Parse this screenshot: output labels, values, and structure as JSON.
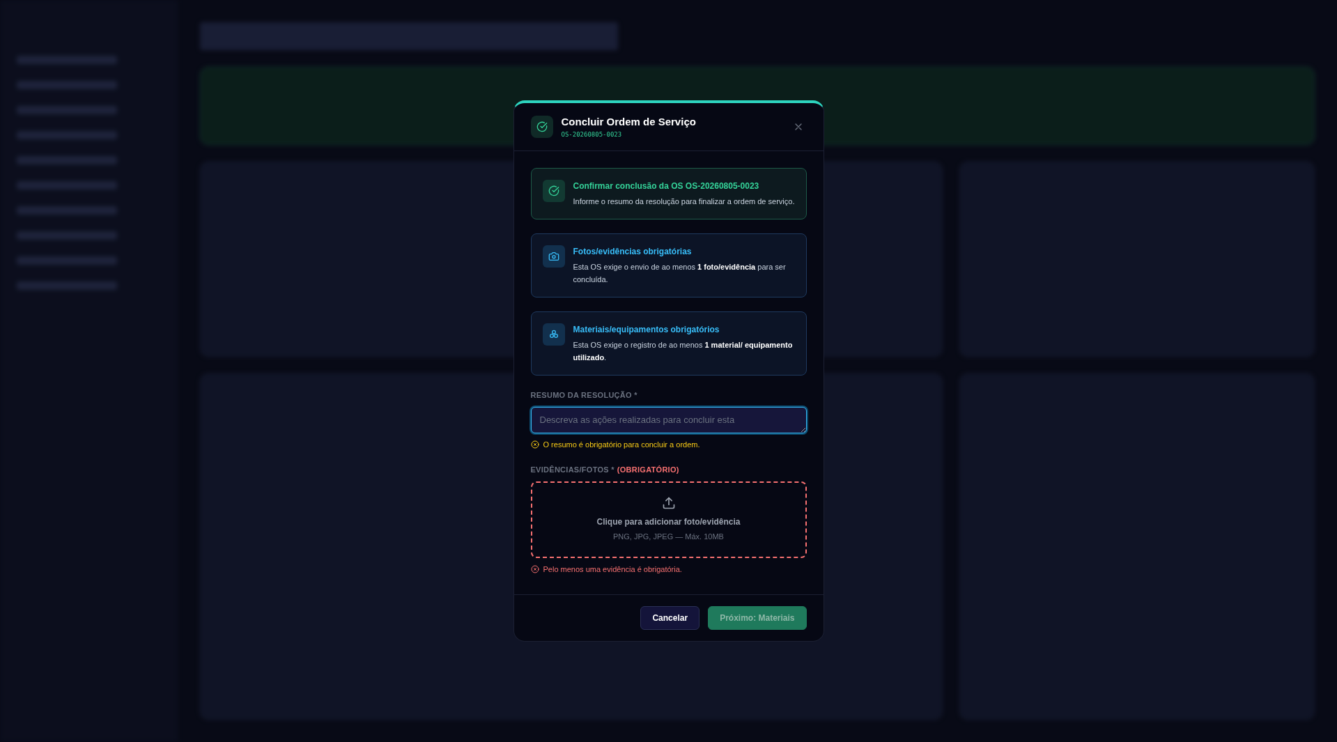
{
  "dialog": {
    "title": "Concluir Ordem de Serviço",
    "code": "OS-20260805-0023",
    "notices": [
      {
        "kind": "success",
        "title": "Confirmar conclusão da OS OS-20260805-0023",
        "text": "Informe o resumo da resolução para finalizar a ordem de serviço."
      },
      {
        "kind": "photo",
        "title": "Fotos/evidências obrigatórias",
        "text": "Esta OS exige o envio de ao menos **1 foto/evidência** para ser concluída."
      },
      {
        "kind": "materials",
        "title": "Materiais/equipamentos obrigatórios",
        "text": "Esta OS exige o registro de ao menos **1 material/ equipamento utilizado**."
      }
    ],
    "summary": {
      "label": "RESUMO DA RESOLUÇÃO *",
      "placeholder": "Descreva as ações realizadas para concluir esta",
      "focused": true,
      "warning": "O resumo é obrigatório para concluir a ordem."
    },
    "evidence": {
      "label": "EVIDÊNCIAS/FOTOS *",
      "required": "(OBRIGATÓRIO)",
      "drop_title": "Clique para adicionar foto/evidência",
      "drop_hint": "PNG, JPG, JPEG — Máx. 10MB",
      "error": "Pelo menos uma evidência é obrigatória."
    },
    "buttons": [
      {
        "kind": "secondary",
        "label": "Cancelar",
        "disabled": false
      },
      {
        "kind": "primary",
        "label": "Próximo: Materiais",
        "disabled": true
      }
    ]
  }
}
